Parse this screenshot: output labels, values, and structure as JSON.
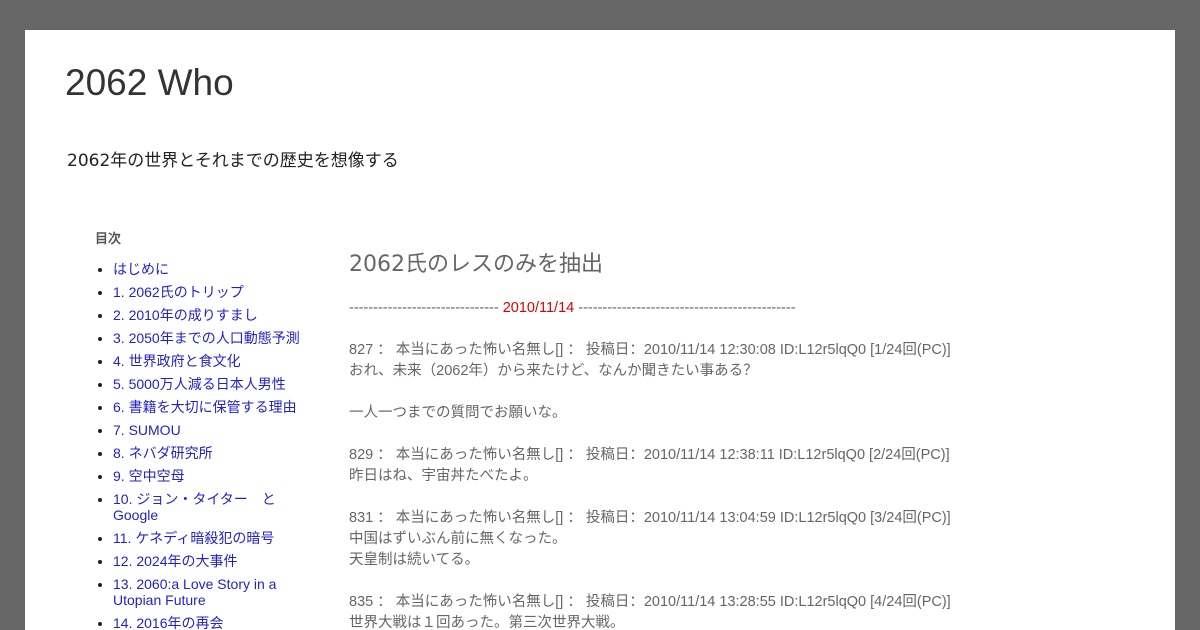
{
  "header": {
    "title": "2062 Who",
    "description": "2062年の世界とそれまでの歴史を想像する"
  },
  "sidebar": {
    "title": "目次",
    "items": [
      {
        "label": "はじめに"
      },
      {
        "label": "1. 2062氏のトリップ"
      },
      {
        "label": "2. 2010年の成りすまし"
      },
      {
        "label": "3. 2050年までの人口動態予測"
      },
      {
        "label": "4. 世界政府と食文化"
      },
      {
        "label": "5. 5000万人減る日本人男性"
      },
      {
        "label": "6. 書籍を大切に保管する理由"
      },
      {
        "label": "7. SUMOU"
      },
      {
        "label": "8. ネバダ研究所"
      },
      {
        "label": "9. 空中空母"
      },
      {
        "label": "10. ジョン・タイター　と Google"
      },
      {
        "label": "11. ケネディ暗殺犯の暗号"
      },
      {
        "label": "12. 2024年の大事件"
      },
      {
        "label": "13. 2060:a Love Story in a Utopian Future"
      },
      {
        "label": "14. 2016年の再会"
      }
    ]
  },
  "post": {
    "title": "2062氏のレスのみを抽出",
    "date_separator": {
      "left": "-------------------------------",
      "date": "2010/11/14",
      "right": "---------------------------------------------"
    },
    "responses": [
      {
        "header": "827 ： 本当にあった怖い名無し[] ： 投稿日：2010/11/14 12:30:08 ID:L12r5lqQ0 [1/24回(PC)]",
        "lines": [
          "おれ、未来（2062年）から来たけど、なんか聞きたい事ある？",
          "",
          "一人一つまでの質問でお願いな。"
        ]
      },
      {
        "header": "829 ： 本当にあった怖い名無し[] ： 投稿日：2010/11/14 12:38:11 ID:L12r5lqQ0 [2/24回(PC)]",
        "lines": [
          "昨日はね、宇宙丼たべたよ。"
        ]
      },
      {
        "header": "831 ： 本当にあった怖い名無し[] ： 投稿日：2010/11/14 13:04:59 ID:L12r5lqQ0 [3/24回(PC)]",
        "lines": [
          "中国はずいぶん前に無くなった。",
          "天皇制は続いてる。"
        ]
      },
      {
        "header": "835 ： 本当にあった怖い名無し[] ： 投稿日：2010/11/14 13:28:55 ID:L12r5lqQ0 [4/24回(PC)]",
        "lines": [
          "世界大戦は１回あった。第三次世界大戦。"
        ]
      }
    ]
  }
}
